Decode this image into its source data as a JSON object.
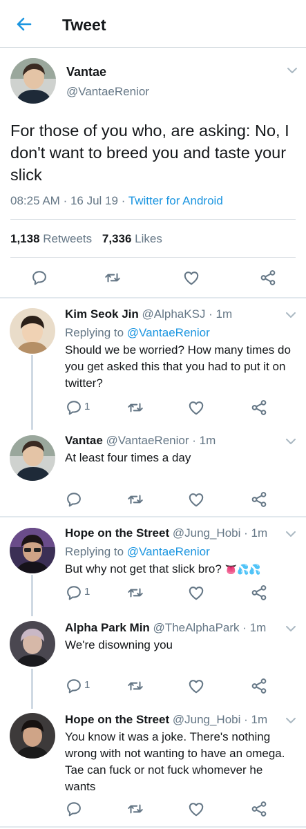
{
  "header": {
    "title": "Tweet"
  },
  "tweet": {
    "display_name": "Vantae",
    "handle": "@VantaeRenior",
    "text": "For those of you who, are asking: No, I don't want to breed you and taste your slick",
    "time": "08:25 AM",
    "date": "16 Jul 19",
    "source": "Twitter for Android",
    "retweets_count": "1,138",
    "retweets_label": "Retweets",
    "likes_count": "7,336",
    "likes_label": "Likes"
  },
  "replies": [
    {
      "display_name": "Kim Seok Jin",
      "handle": "@AlphaKSJ",
      "time": "1m",
      "replying_label": "Replying to",
      "replying_handle": "@VantaeRenior",
      "text": "Should we be worried? How many times do you get asked this that you had to put it on twitter?",
      "reply_count": "1"
    },
    {
      "display_name": "Vantae",
      "handle": "@VantaeRenior",
      "time": "1m",
      "text": "At least four times a day"
    },
    {
      "display_name": "Hope on the Street",
      "handle": "@Jung_Hobi",
      "time": "1m",
      "replying_label": "Replying to",
      "replying_handle": "@VantaeRenior",
      "text": "But why not get that slick bro?",
      "emoji": "👅💦💦",
      "reply_count": "1"
    },
    {
      "display_name": "Alpha Park Min",
      "handle": "@TheAlphaPark",
      "time": "1m",
      "text": "We're disowning you",
      "reply_count": "1"
    },
    {
      "display_name": "Hope on the Street",
      "handle": "@Jung_Hobi",
      "time": "1m",
      "text": "You know it was a joke. There's nothing wrong with not wanting to have an omega. Tae can fuck or not fuck whomever he wants"
    }
  ],
  "icons": {
    "back": "arrow-left-icon",
    "menu": "chevron-down-icon",
    "reply": "reply-icon",
    "retweet": "retweet-icon",
    "like": "heart-icon",
    "share": "share-icon"
  },
  "colors": {
    "accent": "#1b95e0",
    "gray": "#657786",
    "text": "#14171a",
    "divider": "#d7dde2"
  }
}
